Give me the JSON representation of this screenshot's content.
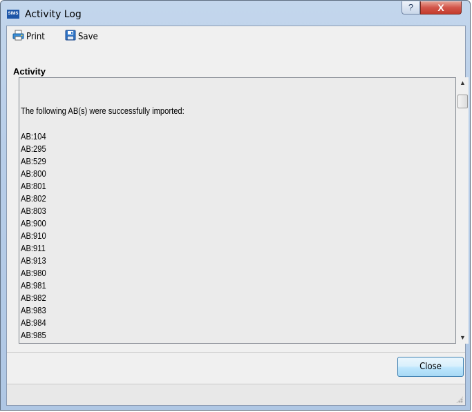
{
  "window": {
    "app_icon_text": "SIMS",
    "title": "Activity Log",
    "help_label": "?",
    "close_label": "X"
  },
  "toolbar": {
    "print_label": "Print",
    "save_label": "Save"
  },
  "activity": {
    "section_label": "Activity",
    "message": "The following AB(s) were successfully imported:",
    "items": [
      "AB:104",
      "AB:295",
      "AB:529",
      "AB:800",
      "AB:801",
      "AB:802",
      "AB:803",
      "AB:900",
      "AB:910",
      "AB:911",
      "AB:913",
      "AB:980",
      "AB:981",
      "AB:982",
      "AB:983",
      "AB:984",
      "AB:985"
    ]
  },
  "footer": {
    "close_button_label": "Close"
  },
  "icons": {
    "print": "printer-icon",
    "save": "floppy-disk-icon",
    "scroll_up": "arrow-up-icon",
    "scroll_down": "arrow-down-icon"
  },
  "colors": {
    "titlebar": "#b7cde8",
    "close_red": "#c33b2c",
    "log_background": "#ebebeb",
    "button_blue": "#bee6fd"
  }
}
